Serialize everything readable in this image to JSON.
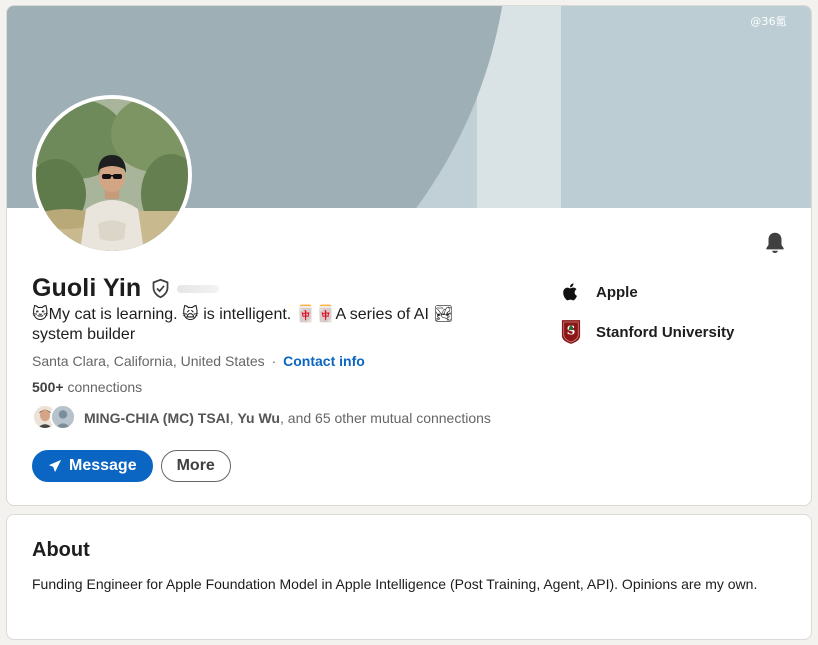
{
  "watermark": "@36氪",
  "profile": {
    "name": "Guoli Yin",
    "headline": "🐱My cat is learning. 🙀 is intelligent. 🀄🀄A series of AI 🏞 system builder",
    "location": "Santa Clara, California, United States",
    "location_separator": "·",
    "contact_info_label": "Contact info",
    "connections_count": "500+",
    "connections_label": "connections",
    "mutual": {
      "name1": "MING-CHIA (MC) TSAI",
      "sep1": ", ",
      "name2": "Yu Wu",
      "rest": ", and 65 other mutual connections"
    },
    "buttons": {
      "message_label": "Message",
      "more_label": "More"
    },
    "orgs": [
      {
        "name": "Apple",
        "icon": "apple-logo-icon"
      },
      {
        "name": "Stanford University",
        "icon": "stanford-logo-icon"
      }
    ]
  },
  "about": {
    "title": "About",
    "text": "Funding Engineer for Apple Foundation Model in Apple Intelligence (Post Training, Agent, API). Opinions are my own."
  },
  "colors": {
    "accent": "#0a66c2",
    "banner_main": "#9eb0b5",
    "banner_right": "#bccdd3",
    "stanford_red": "#8c1515"
  }
}
